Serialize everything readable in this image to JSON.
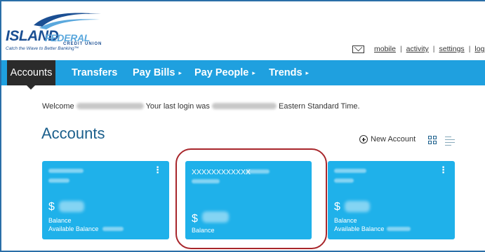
{
  "brand": {
    "name_part1": "ISLAND",
    "name_part2": "FEDERAL",
    "subtitle": "CREDIT UNION",
    "tagline": "Catch the Wave to Better Banking™",
    "primary_color": "#1b4f93",
    "accent_color": "#1fa0df"
  },
  "utility": {
    "mail_icon": "mail-icon",
    "links": [
      "mobile",
      "activity",
      "settings",
      "log o"
    ],
    "separator": "|"
  },
  "nav": {
    "items": [
      {
        "label": "Accounts",
        "active": true
      },
      {
        "label": "Transfers"
      },
      {
        "label": "Pay Bills",
        "caret": "▸"
      },
      {
        "label": "Pay People",
        "caret": "▸"
      },
      {
        "label": "Trends",
        "caret": "▸"
      }
    ]
  },
  "welcome": {
    "prefix": "Welcome",
    "middle": "Your last login was",
    "suffix": "Eastern Standard Time."
  },
  "accounts": {
    "title": "Accounts",
    "new_account_label": "New Account",
    "cards": [
      {
        "name": "",
        "currency": "$",
        "balance_label": "Balance",
        "available_label": "Available Balance"
      },
      {
        "name": "XXXXXXXXXXXX",
        "currency": "$",
        "balance_label": "Balance"
      },
      {
        "name": "",
        "currency": "$",
        "balance_label": "Balance",
        "available_label": "Available Balance"
      }
    ],
    "menu_glyph": "⋮"
  }
}
